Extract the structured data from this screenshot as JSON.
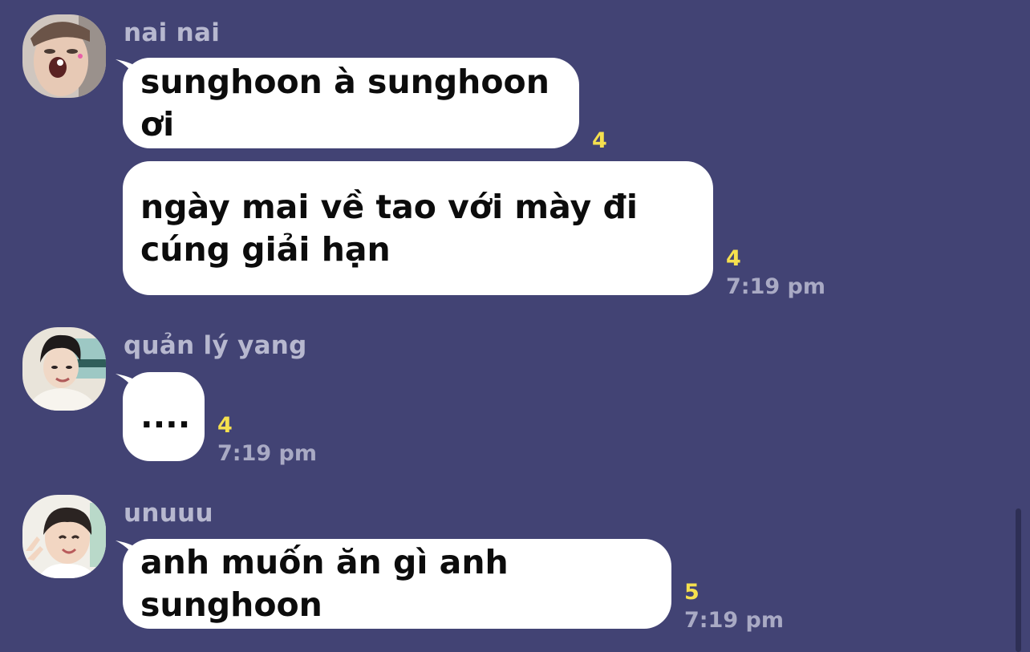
{
  "messages": [
    {
      "sender": "nai nai",
      "avatar": "avatar-nai-nai",
      "bubbles": [
        {
          "text": "sunghoon à sunghoon ơi",
          "unread": "4"
        },
        {
          "text": "ngày mai về tao với mày đi cúng giải hạn",
          "unread": "4",
          "time": "7:19 pm"
        }
      ]
    },
    {
      "sender": "quản lý yang",
      "avatar": "avatar-quan-ly-yang",
      "bubbles": [
        {
          "text": "....",
          "unread": "4",
          "time": "7:19 pm"
        }
      ]
    },
    {
      "sender": "unuuu",
      "avatar": "avatar-unuuu",
      "bubbles": [
        {
          "text": "anh muốn ăn gì anh sunghoon",
          "unread": "5",
          "time": "7:19 pm"
        }
      ]
    }
  ],
  "colors": {
    "background": "#424374",
    "bubble": "#ffffff",
    "unread": "#f5e04e",
    "meta_text": "#a9aac4"
  }
}
